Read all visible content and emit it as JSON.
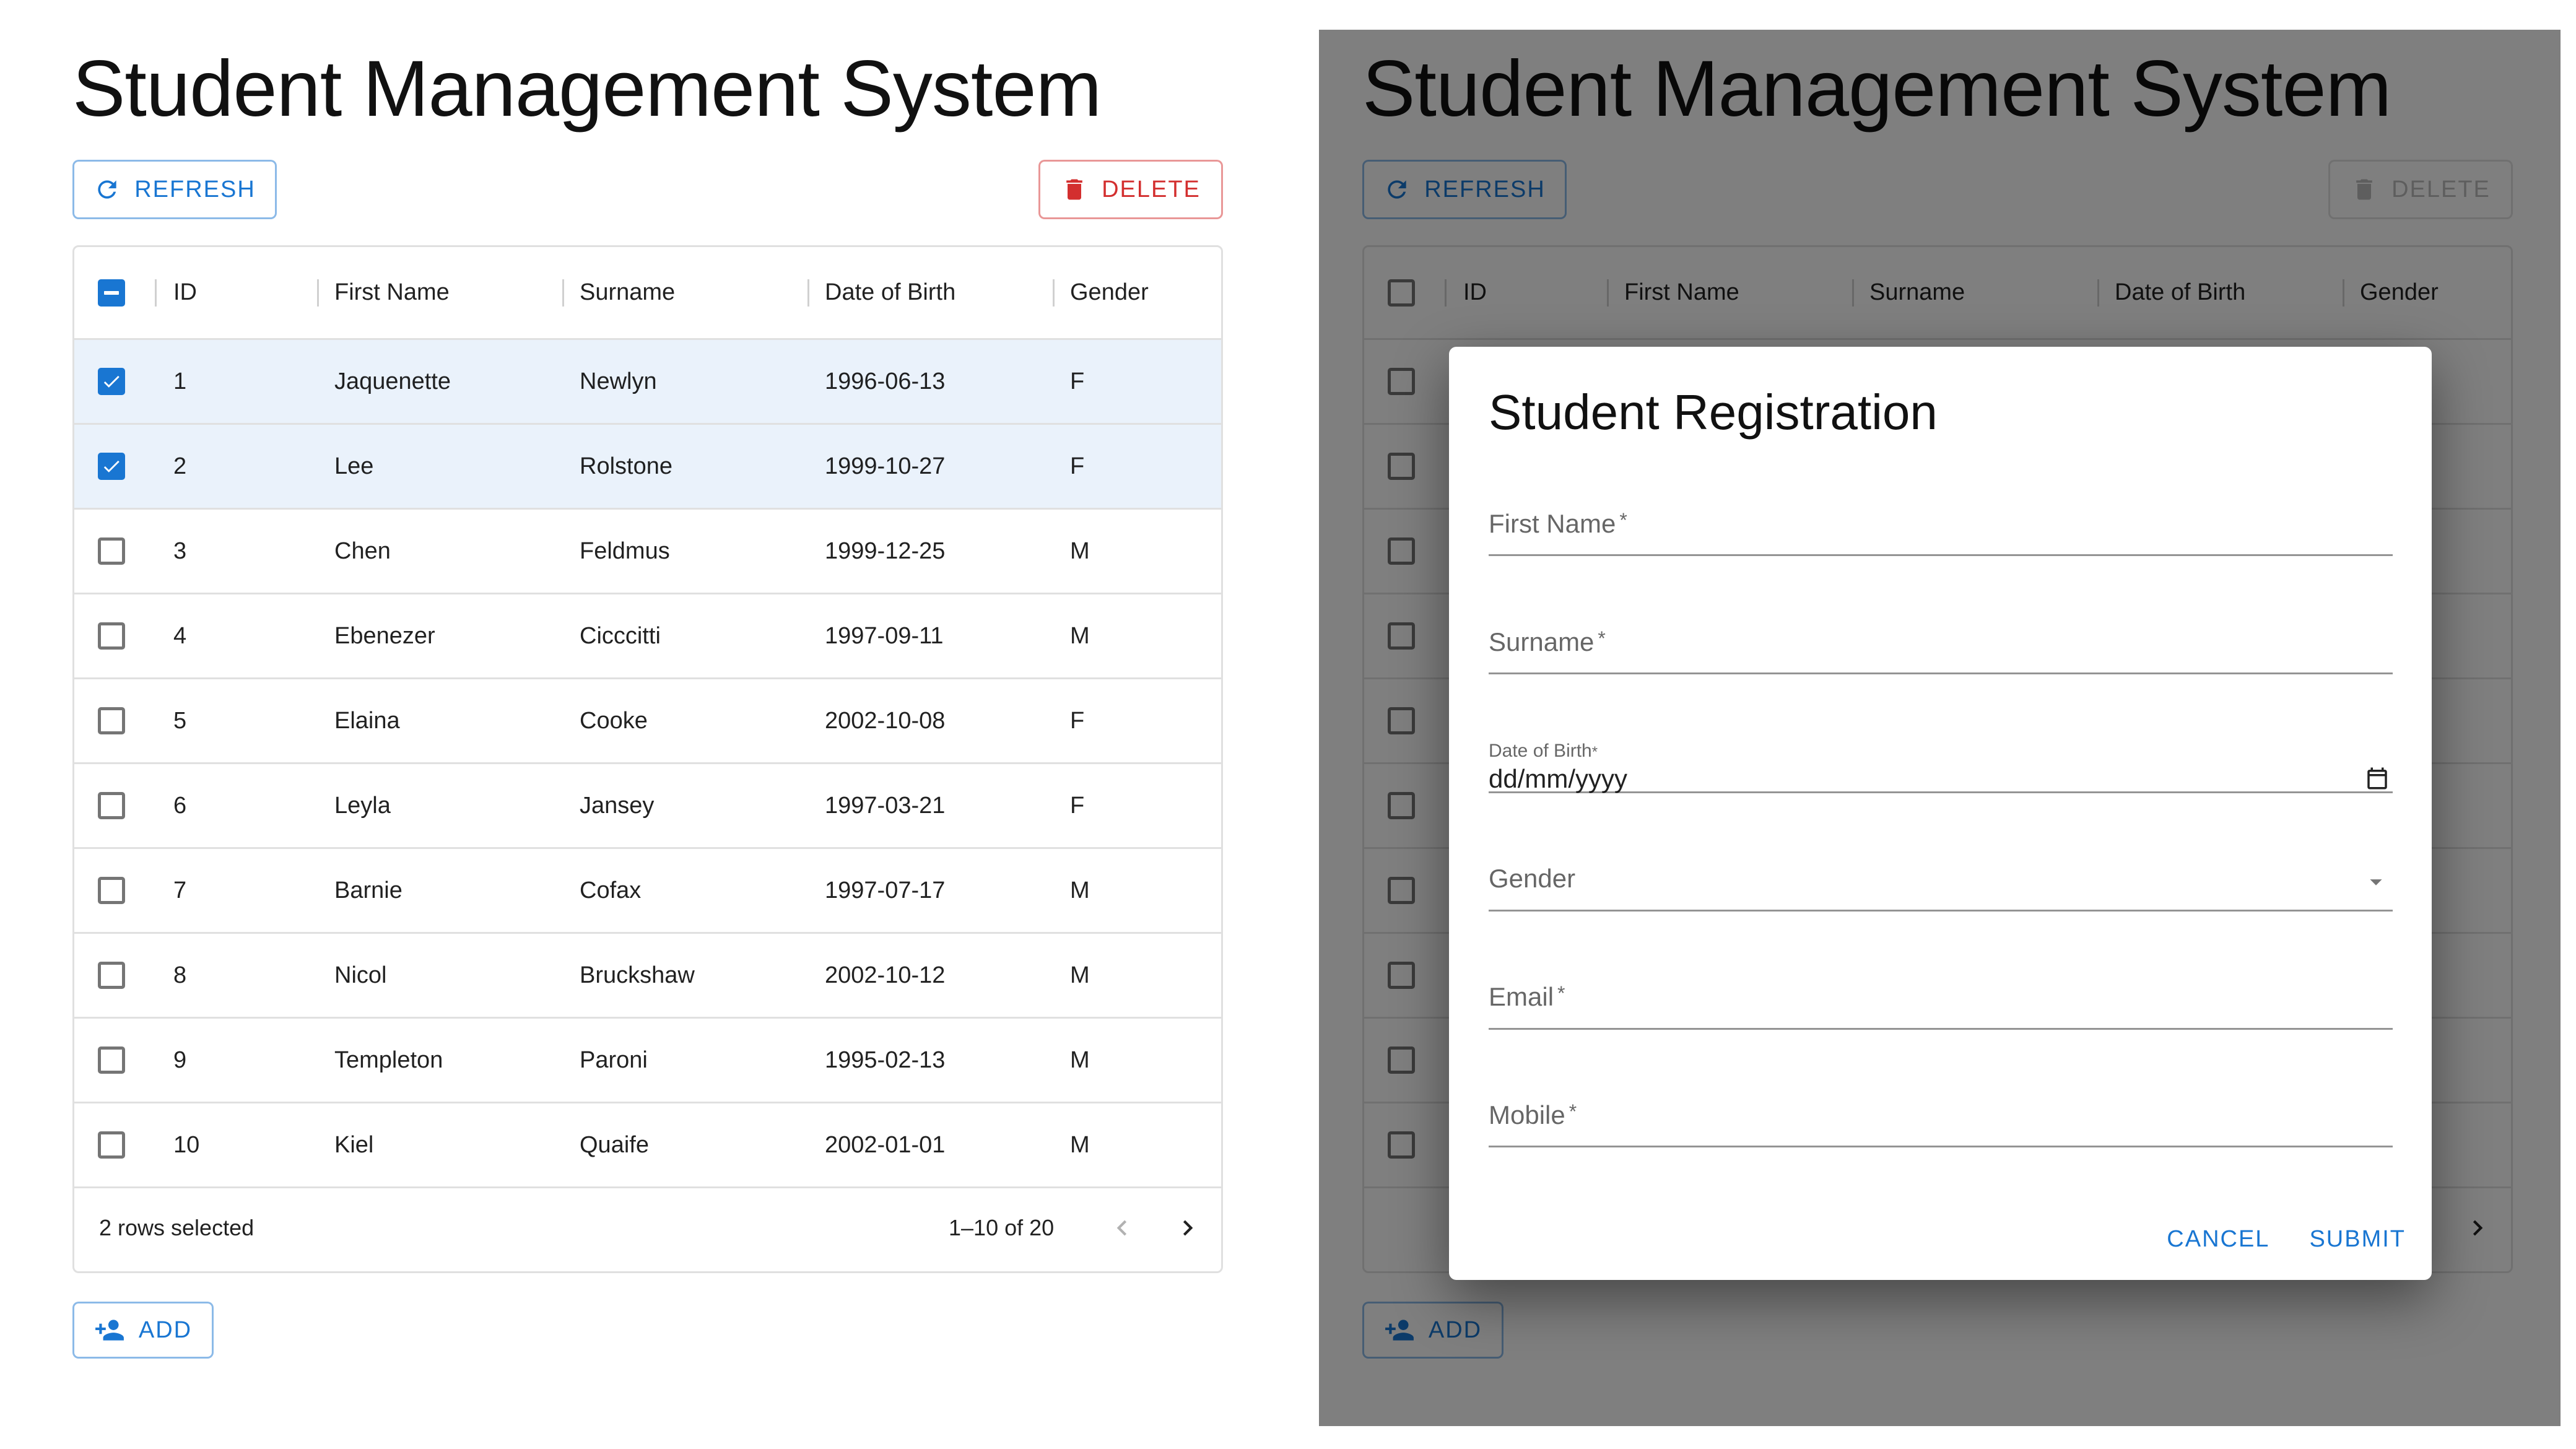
{
  "app": {
    "title": "Student Management System"
  },
  "toolbar": {
    "refresh_label": "REFRESH",
    "delete_label": "DELETE",
    "add_label": "ADD"
  },
  "grid": {
    "columns": [
      "ID",
      "First Name",
      "Surname",
      "Date of Birth",
      "Gender"
    ],
    "rows": [
      {
        "id": "1",
        "first": "Jaquenette",
        "surname": "Newlyn",
        "dob": "1996-06-13",
        "gender": "F",
        "selected": true
      },
      {
        "id": "2",
        "first": "Lee",
        "surname": "Rolstone",
        "dob": "1999-10-27",
        "gender": "F",
        "selected": true
      },
      {
        "id": "3",
        "first": "Chen",
        "surname": "Feldmus",
        "dob": "1999-12-25",
        "gender": "M",
        "selected": false
      },
      {
        "id": "4",
        "first": "Ebenezer",
        "surname": "Cicccitti",
        "dob": "1997-09-11",
        "gender": "M",
        "selected": false
      },
      {
        "id": "5",
        "first": "Elaina",
        "surname": "Cooke",
        "dob": "2002-10-08",
        "gender": "F",
        "selected": false
      },
      {
        "id": "6",
        "first": "Leyla",
        "surname": "Jansey",
        "dob": "1997-03-21",
        "gender": "F",
        "selected": false
      },
      {
        "id": "7",
        "first": "Barnie",
        "surname": "Cofax",
        "dob": "1997-07-17",
        "gender": "M",
        "selected": false
      },
      {
        "id": "8",
        "first": "Nicol",
        "surname": "Bruckshaw",
        "dob": "2002-10-12",
        "gender": "M",
        "selected": false
      },
      {
        "id": "9",
        "first": "Templeton",
        "surname": "Paroni",
        "dob": "1995-02-13",
        "gender": "M",
        "selected": false
      },
      {
        "id": "10",
        "first": "Kiel",
        "surname": "Quaife",
        "dob": "2002-01-01",
        "gender": "M",
        "selected": false
      }
    ],
    "selected_text": "2 rows selected",
    "pagination_text": "1–10 of 20"
  },
  "dialog": {
    "title": "Student Registration",
    "first_name_label": "First Name",
    "surname_label": "Surname",
    "dob_label": "Date of Birth",
    "dob_placeholder": "dd/mm/yyyy",
    "gender_label": "Gender",
    "email_label": "Email",
    "mobile_label": "Mobile",
    "required_mark": "*",
    "cancel_label": "CANCEL",
    "submit_label": "SUBMIT"
  },
  "colors": {
    "primary": "#1976d2",
    "error": "#d32f2f",
    "selected_row": "#eaf2fb",
    "overlay": "rgba(0,0,0,0.5)"
  },
  "icons": [
    "refresh-icon",
    "delete-icon",
    "person-add-icon",
    "chevron-left-icon",
    "chevron-right-icon",
    "calendar-icon",
    "dropdown-arrow-icon"
  ]
}
